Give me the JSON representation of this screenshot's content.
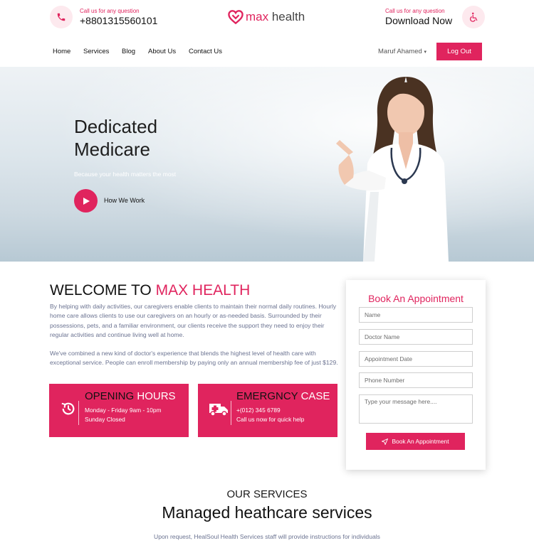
{
  "colors": {
    "accent": "#e0245e",
    "text": "#111111",
    "muted": "#6b7391"
  },
  "topbar": {
    "left_small": "Call us for any question",
    "phone": "+8801315560101",
    "right_small": "Call us for any question",
    "right_big": "Download Now",
    "logo_icon": "heart-icon",
    "logo_prefix": "max",
    "logo_suffix": " health"
  },
  "nav": {
    "items": [
      "Home",
      "Services",
      "Blog",
      "About Us",
      "Contact Us"
    ],
    "user": "Maruf Ahamed",
    "logout": "Log Out"
  },
  "hero": {
    "title_line1": "Dedicated",
    "title_line2": "Medicare",
    "subtitle": "Because your health matters the most",
    "cta": "How We Work"
  },
  "welcome": {
    "title_prefix": "WELCOME TO ",
    "title_accent": "MAX HEALTH",
    "para1": "By helping with daily activities, our caregivers enable clients to maintain their normal daily routines. Hourly home care allows clients to use our caregivers on an hourly or as-needed basis. Surrounded by their possessions, pets, and a familiar environment, our clients receive the support they need to enjoy their regular activities and continue living well at home.",
    "para2": "We've combined a new kind of doctor's experience that blends the highest level of health care with exceptional service. People can enroll membership by paying only an annual membership fee of just $129."
  },
  "cards": {
    "hours": {
      "title_dark": "OPENING",
      "title_light": " HOURS",
      "line1": "Monday - Friday 9am - 10pm",
      "line2": "Sunday Closed",
      "icon": "clock-history-icon"
    },
    "emergency": {
      "title_dark": "EMERGNCY",
      "title_light": " CASE",
      "line1": "+(012) 345 6789",
      "line2": "Call us now for quick help",
      "icon": "ambulance-icon"
    }
  },
  "appointment": {
    "title": "Book An Appointment",
    "name_placeholder": "Name",
    "doctor_placeholder": "Doctor Name",
    "date_placeholder": "Appointment Date",
    "phone_placeholder": "Phone Number",
    "message_placeholder": "Type your message here....",
    "button": "Book An Appointment"
  },
  "services": {
    "kicker": "OUR SERVICES",
    "title": "Managed heathcare services",
    "subtitle": "Upon request, HealSoul Health Services staff will provide instructions for individuals"
  }
}
